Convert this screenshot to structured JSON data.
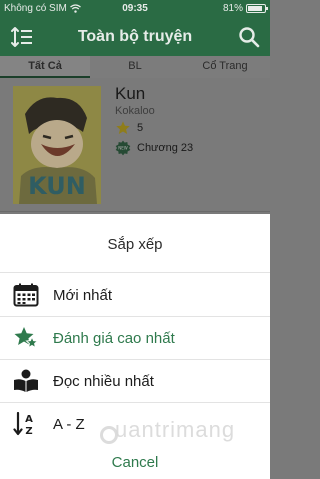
{
  "status_bar": {
    "carrier": "Không có SIM",
    "time": "09:35",
    "battery": "81%"
  },
  "header": {
    "title": "Toàn bộ truyện"
  },
  "tabs": [
    {
      "label": "Tất Cả"
    },
    {
      "label": "BL"
    },
    {
      "label": "Cổ Trang"
    }
  ],
  "book": {
    "title": "Kun",
    "author": "Kokaloo",
    "rating": "5",
    "chapter": "Chương 23",
    "cover_text": "KUN"
  },
  "sheet": {
    "title": "Sắp xếp",
    "options": [
      {
        "label": "Mới nhất",
        "icon": "calendar-icon"
      },
      {
        "label": "Đánh giá cao nhất",
        "icon": "star-rating-icon"
      },
      {
        "label": "Đọc nhiều nhất",
        "icon": "reader-icon"
      },
      {
        "label": "A - Z",
        "icon": "sort-alpha-icon"
      }
    ],
    "cancel": "Cancel"
  },
  "watermark": "uantrimang",
  "colors": {
    "primary": "#2a6b44",
    "accent": "#2f7a4d",
    "star": "#d9b600"
  }
}
